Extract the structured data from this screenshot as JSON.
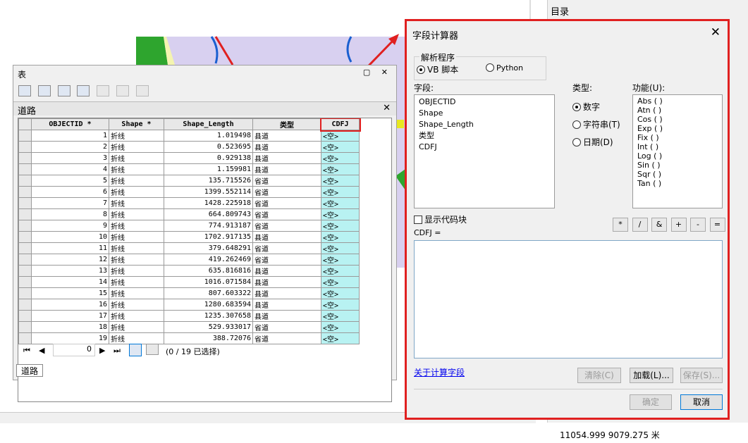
{
  "catalog": {
    "title": "目录"
  },
  "coords": {
    "text": "11054.999  9079.275 米"
  },
  "table_window": {
    "title": "表",
    "tab_label": "道路",
    "bottom_tab": "道路",
    "columns": [
      "OBJECTID *",
      "Shape *",
      "Shape_Length",
      "类型",
      "CDFJ"
    ],
    "rows": [
      [
        "1",
        "折线",
        "1.019498",
        "县道",
        "<空>"
      ],
      [
        "2",
        "折线",
        "0.523695",
        "县道",
        "<空>"
      ],
      [
        "3",
        "折线",
        "0.929138",
        "县道",
        "<空>"
      ],
      [
        "4",
        "折线",
        "1.159981",
        "县道",
        "<空>"
      ],
      [
        "5",
        "折线",
        "135.715526",
        "省道",
        "<空>"
      ],
      [
        "6",
        "折线",
        "1399.552114",
        "省道",
        "<空>"
      ],
      [
        "7",
        "折线",
        "1428.225918",
        "省道",
        "<空>"
      ],
      [
        "8",
        "折线",
        "664.809743",
        "省道",
        "<空>"
      ],
      [
        "9",
        "折线",
        "774.913187",
        "省道",
        "<空>"
      ],
      [
        "10",
        "折线",
        "1702.917135",
        "县道",
        "<空>"
      ],
      [
        "11",
        "折线",
        "379.648291",
        "省道",
        "<空>"
      ],
      [
        "12",
        "折线",
        "419.262469",
        "省道",
        "<空>"
      ],
      [
        "13",
        "折线",
        "635.816816",
        "县道",
        "<空>"
      ],
      [
        "14",
        "折线",
        "1016.071584",
        "县道",
        "<空>"
      ],
      [
        "15",
        "折线",
        "807.603322",
        "县道",
        "<空>"
      ],
      [
        "16",
        "折线",
        "1280.683594",
        "县道",
        "<空>"
      ],
      [
        "17",
        "折线",
        "1235.307658",
        "县道",
        "<空>"
      ],
      [
        "18",
        "折线",
        "529.933017",
        "省道",
        "<空>"
      ],
      [
        "19",
        "折线",
        "388.72076",
        "省道",
        "<空>"
      ]
    ],
    "nav": {
      "record": "0",
      "status": "(0 / 19 已选择)"
    }
  },
  "calc": {
    "title": "字段计算器",
    "parser_label": "解析程序",
    "parser_vb": "VB 脚本",
    "parser_python": "Python",
    "fields_label": "字段:",
    "fields": [
      "OBJECTID",
      "Shape",
      "Shape_Length",
      "类型",
      "CDFJ"
    ],
    "type_label": "类型:",
    "type_number": "数字",
    "type_string": "字符串(T)",
    "type_date": "日期(D)",
    "func_label": "功能(U):",
    "functions": [
      "Abs ( )",
      "Atn ( )",
      "Cos ( )",
      "Exp ( )",
      "Fix ( )",
      "Int ( )",
      "Log ( )",
      "Sin ( )",
      "Sqr ( )",
      "Tan ( )"
    ],
    "show_codeblock": "显示代码块",
    "expr_label": "CDFJ =",
    "operators": [
      "*",
      "/",
      "&",
      "+",
      "-",
      "="
    ],
    "about_link": "关于计算字段",
    "clear_btn": "清除(C)",
    "load_btn": "加载(L)...",
    "save_btn": "保存(S)...",
    "ok_btn": "确定",
    "cancel_btn": "取消"
  },
  "colors": {
    "highlight_red": "#e02020",
    "cdfj_cell": "#b8f2f2",
    "map_lilac": "#d8d0f0",
    "map_green": "#2ea52e",
    "road_blue": "#1a5fd0"
  }
}
